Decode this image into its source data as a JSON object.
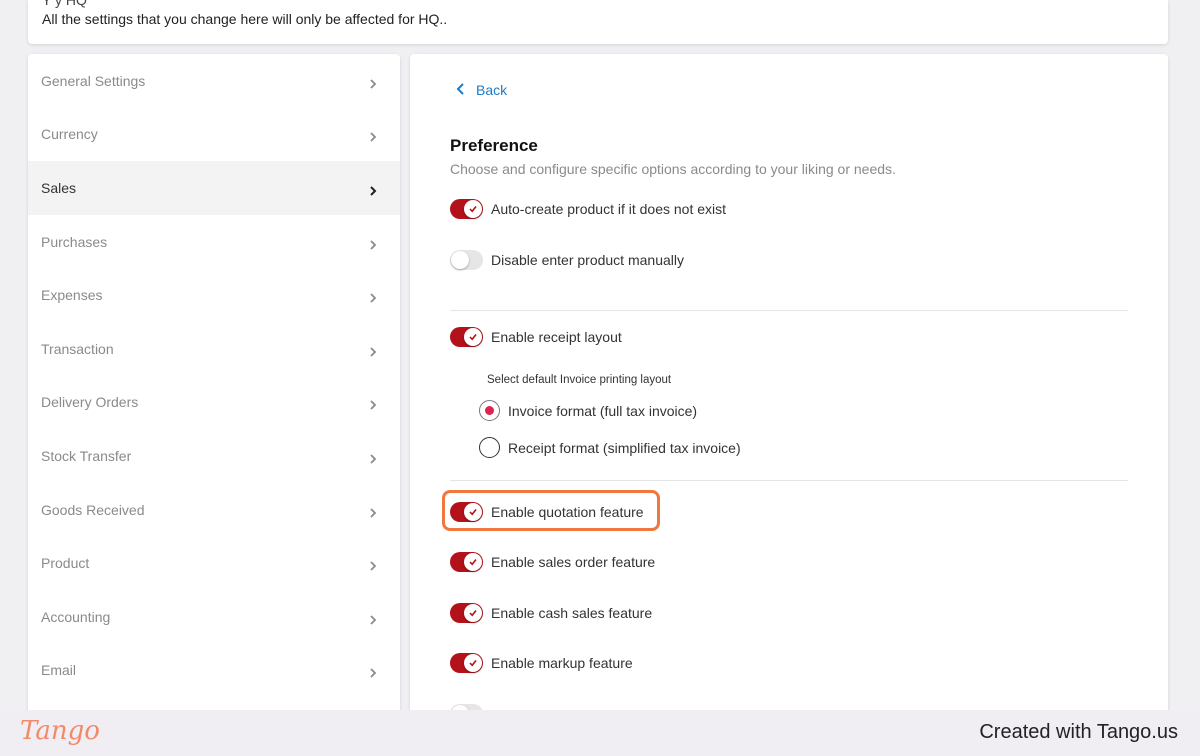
{
  "header": {
    "cut_text": "Y          y              HQ",
    "message": "All the settings that you change here will only be affected for HQ.."
  },
  "sidebar": {
    "items": [
      {
        "label": "General Settings",
        "active": false
      },
      {
        "label": "Currency",
        "active": false
      },
      {
        "label": "Sales",
        "active": true
      },
      {
        "label": "Purchases",
        "active": false
      },
      {
        "label": "Expenses",
        "active": false
      },
      {
        "label": "Transaction",
        "active": false
      },
      {
        "label": "Delivery Orders",
        "active": false
      },
      {
        "label": "Stock Transfer",
        "active": false
      },
      {
        "label": "Goods Received",
        "active": false
      },
      {
        "label": "Product",
        "active": false
      },
      {
        "label": "Accounting",
        "active": false
      },
      {
        "label": "Email",
        "active": false
      }
    ]
  },
  "main": {
    "back_label": "Back",
    "title": "Preference",
    "subtitle": "Choose and configure specific options according to your liking or needs.",
    "toggles": {
      "auto_create": {
        "label": "Auto-create product if it does not exist",
        "on": true
      },
      "disable_manual": {
        "label": "Disable enter product manually",
        "on": false
      },
      "receipt_layout": {
        "label": "Enable receipt layout",
        "on": true
      },
      "quotation": {
        "label": "Enable quotation feature",
        "on": true
      },
      "sales_order": {
        "label": "Enable sales order feature",
        "on": true
      },
      "cash_sales": {
        "label": "Enable cash sales feature",
        "on": true
      },
      "markup": {
        "label": "Enable markup feature",
        "on": true
      }
    },
    "print_layout": {
      "label": "Select default Invoice printing layout",
      "options": [
        {
          "label": "Invoice format (full tax invoice)",
          "selected": true
        },
        {
          "label": "Receipt format (simplified tax invoice)",
          "selected": false
        }
      ]
    }
  },
  "footer": {
    "logo": "Tango",
    "credit": "Created with Tango.us"
  },
  "colors": {
    "toggle_on": "#b3121a",
    "radio_selected": "#e0234e",
    "highlight": "#f0773d",
    "link": "#1e7bc7"
  }
}
